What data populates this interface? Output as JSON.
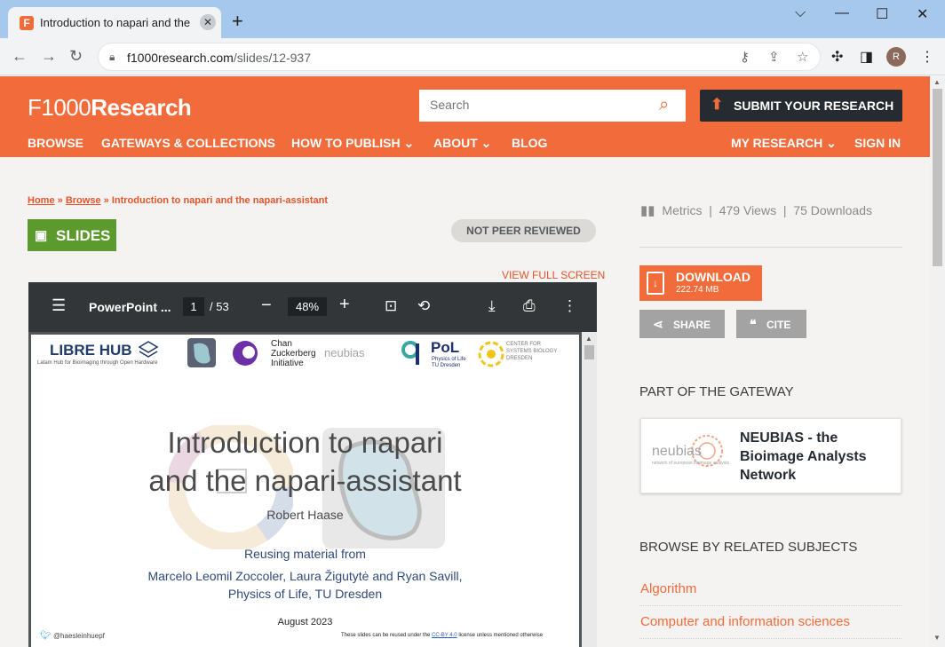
{
  "browser": {
    "tab_title": "Introduction to napari and the n",
    "tab_favicon": "F",
    "new_tab": "+",
    "minimize": "⌵",
    "min2": "—",
    "maximize": "☐",
    "close": "✕",
    "url_host": "f1000research.com",
    "url_path": "/slides/12-937",
    "avatar_letter": "R"
  },
  "header": {
    "logo_f": "F1000",
    "logo_r": "Research",
    "search_placeholder": "Search",
    "submit_label": "SUBMIT YOUR RESEARCH",
    "nav": [
      "BROWSE",
      "GATEWAYS & COLLECTIONS",
      "HOW TO PUBLISH ⌄",
      "ABOUT ⌄",
      "BLOG",
      "MY RESEARCH ⌄",
      "SIGN IN"
    ]
  },
  "breadcrumb": {
    "home": "Home",
    "browse": "Browse",
    "current": "Introduction to napari and the napari-assistant",
    "sep": "»"
  },
  "badge": {
    "slides": "SLIDES",
    "peer": "NOT PEER REVIEWED"
  },
  "view_full_screen": "VIEW FULL SCREEN",
  "viewer": {
    "file_name": "PowerPoint ...",
    "page": "1",
    "page_total": "/ 53",
    "zoom": "48%"
  },
  "slide": {
    "libre_hub": "LIBRE HUB",
    "libre_sub": "Latam Hub for Bioimaging through Open Hardware",
    "czi": "Chan Zuckerberg Initiative",
    "neubias": "neubias",
    "pol": "PoL",
    "pol_sub": "Physics of Life TU Dresden",
    "csb": "CENTER FOR SYSTEMS BIOLOGY DRESDEN",
    "title_line1": "Introduction to napari",
    "title_line2": "and the napari-assistant",
    "author": "Robert Haase",
    "reusing": "Reusing material from",
    "names1": "Marcelo Leomil Zoccoler, Laura Žigutytė and Ryan Savill,",
    "names2": "Physics of Life, TU Dresden",
    "date": "August 2023",
    "twitter": "@haesleinhuepf",
    "license_pre": "These slides can be reused under the ",
    "license_link": "CC-BY 4.0",
    "license_post": " license unless mentioned otherwise"
  },
  "sidebar": {
    "metrics_label": "Metrics",
    "views": "479 Views",
    "downloads": "75 Downloads",
    "download_label": "DOWNLOAD",
    "download_size": "222.74 MB",
    "share_label": "SHARE",
    "cite_label": "CITE",
    "gateway_heading": "PART OF THE GATEWAY",
    "gateway_logo": "neubias",
    "gateway_logo_sub": "network of european bioimage analysts",
    "gateway_name": "NEUBIAS - the Bioimage Analysts Network",
    "subjects_heading": "BROWSE BY RELATED SUBJECTS",
    "subjects": [
      "Algorithm",
      "Computer and information sciences"
    ]
  },
  "colors": {
    "brand": "#f26b3a",
    "dark": "#252b30",
    "slides_green": "#5c9a2d"
  }
}
